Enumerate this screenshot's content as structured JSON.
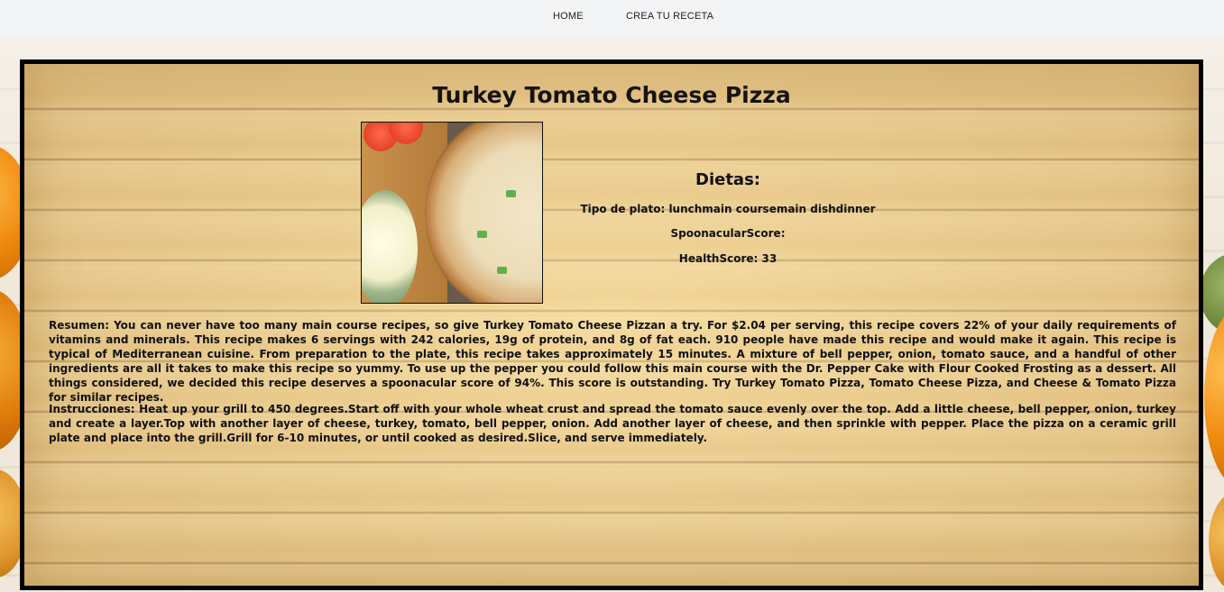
{
  "nav": {
    "home": "HOME",
    "crea": "CREA TU RECETA"
  },
  "recipe": {
    "title": "Turkey Tomato Cheese Pizza",
    "dietas_heading": "Dietas:",
    "tipo_de_plato": "Tipo de plato: lunchmain coursemain dishdinner",
    "spoonacular_score": "SpoonacularScore:",
    "health_score": "HealthScore: 33",
    "resumen": "Resumen: You can never have too many main course recipes, so give Turkey Tomato Cheese Pizzan a try. For $2.04 per serving, this recipe covers 22% of your daily requirements of vitamins and minerals. This recipe makes 6 servings with 242 calories, 19g of protein, and 8g of fat each. 910 people have made this recipe and would make it again. This recipe is typical of Mediterranean cuisine. From preparation to the plate, this recipe takes approximately 15 minutes. A mixture of bell pepper, onion, tomato sauce, and a handful of other ingredients are all it takes to make this recipe so yummy. To use up the pepper you could follow this main course with the Dr. Pepper Cake with Flour Cooked Frosting as a dessert. All things considered, we decided this recipe deserves a spoonacular score of 94%. This score is outstanding. Try Turkey Tomato Pizza, Tomato Cheese Pizza, and Cheese & Tomato Pizza for similar recipes.",
    "instrucciones": "Instrucciones: Heat up your grill to 450 degrees.Start off with your whole wheat crust and spread the tomato sauce evenly over the top. Add a little cheese, bell pepper, onion, turkey and create a layer.Top with another layer of cheese, turkey, tomato, bell pepper, onion. Add another layer of cheese, and then sprinkle with pepper. Place the pizza on a ceramic grill plate and place into the grill.Grill for 6-10 minutes, or until cooked as desired.Slice, and serve immediately."
  }
}
